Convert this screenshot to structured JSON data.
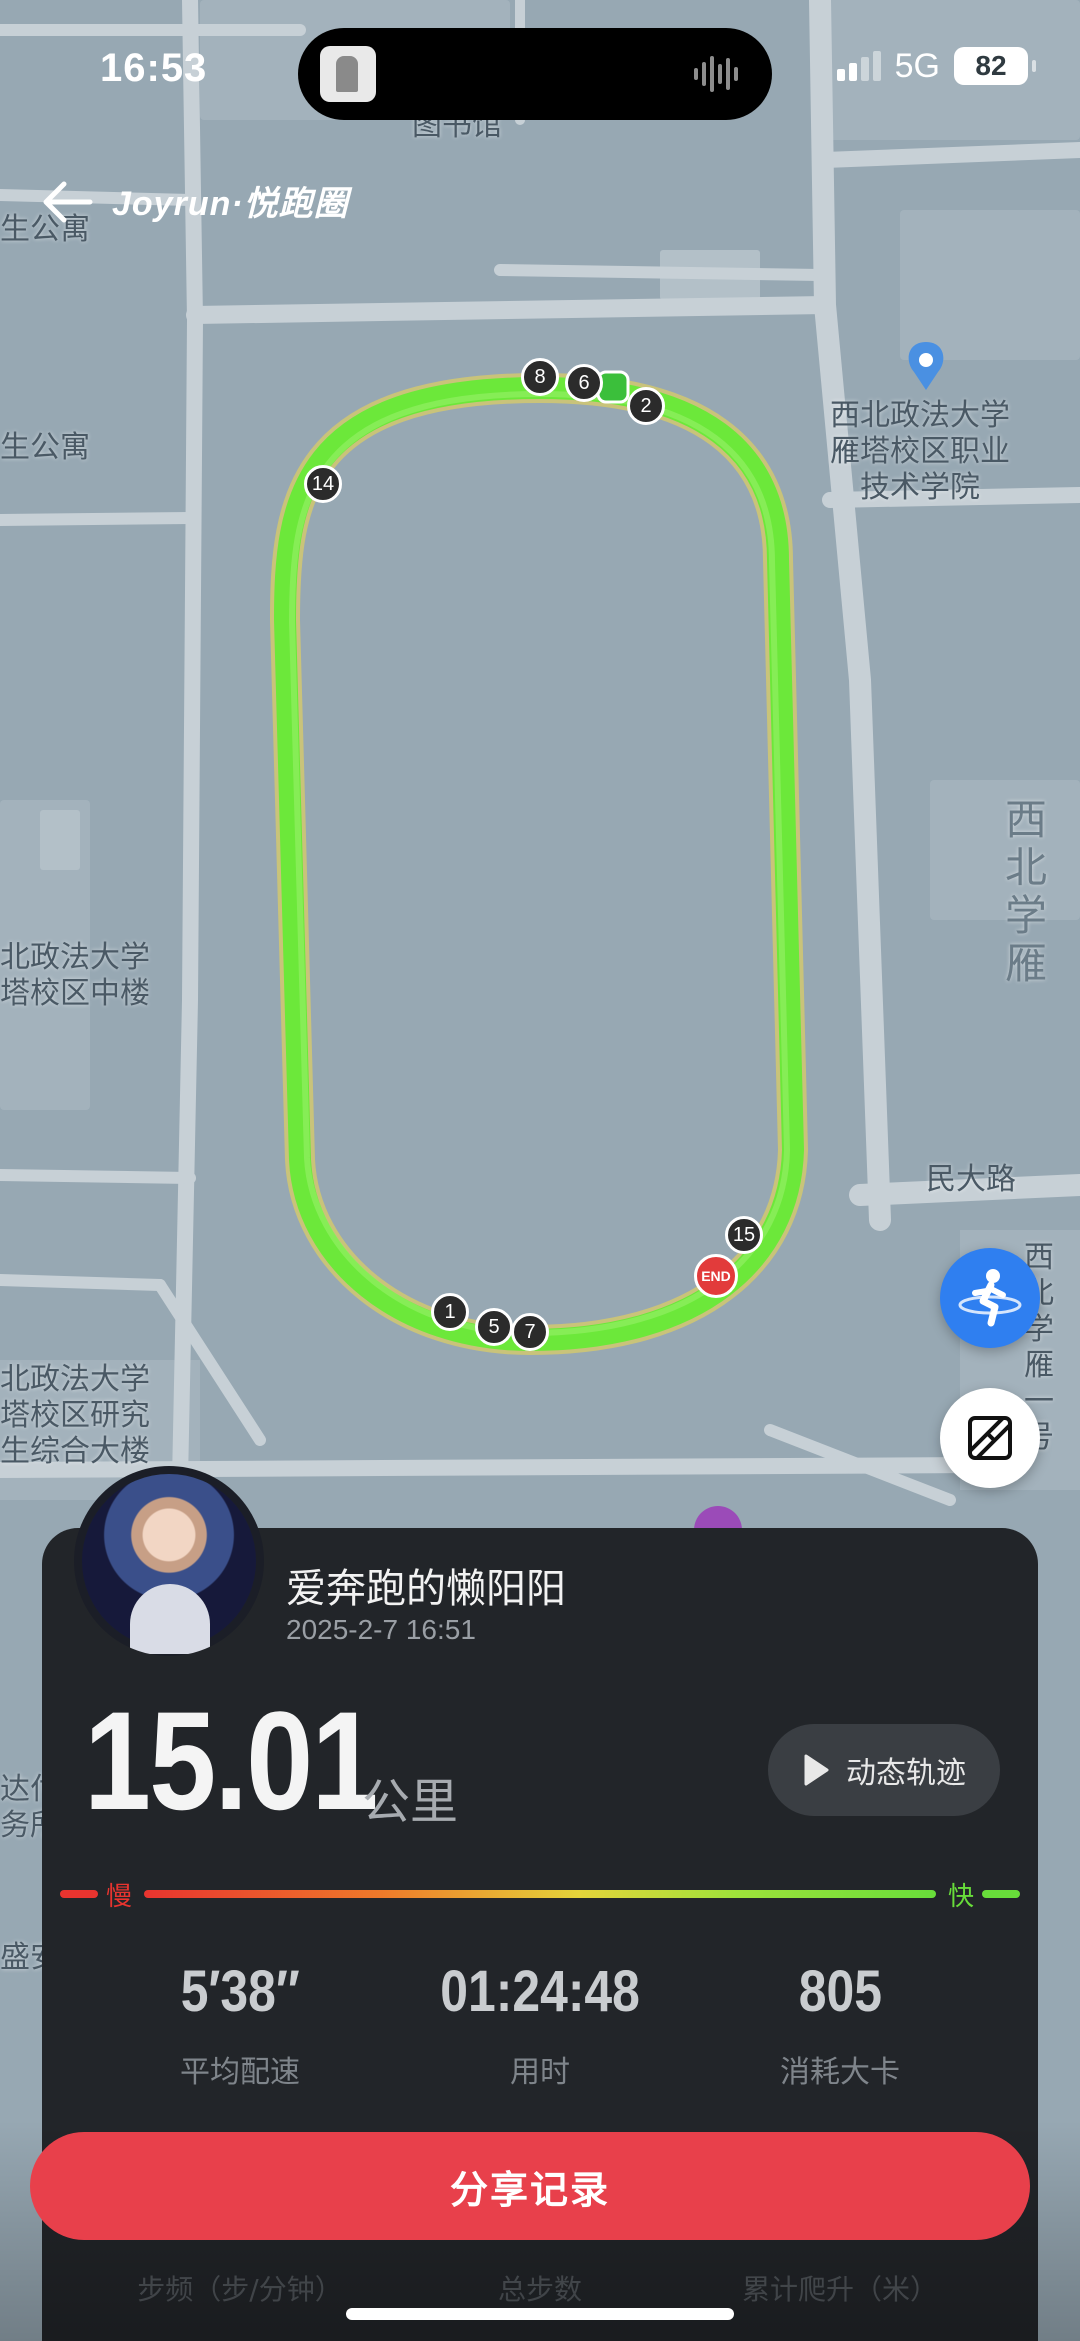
{
  "status_bar": {
    "time": "16:53",
    "network": "5G",
    "battery": "82"
  },
  "header": {
    "brand": "Joyrun·悦跑圈"
  },
  "map": {
    "labels": {
      "library": "图书馆",
      "apartment1": "生公寓",
      "apartment2": "生公寓",
      "college": "西北政法大学\n雁塔校区职业\n技术学院",
      "right_big": "西北\n学雁",
      "middle_building": "北政法大学\n塔校区中楼",
      "road": "民大路",
      "right_small": "西北\n学雁\n一号",
      "research_building": "北政法大学\n塔校区研究\n生综合大楼",
      "left_edge1": "达付\n务所",
      "left_edge2": "盛安"
    },
    "km_markers": [
      "8",
      "6",
      "2",
      "14",
      "15",
      "1",
      "5",
      "7"
    ],
    "end_label": "END",
    "route_color": "#6ce83a"
  },
  "summary": {
    "username": "爱奔跑的懒阳阳",
    "datetime": "2025-2-7 16:51",
    "distance": "15.01",
    "distance_unit": "公里",
    "replay_label": "动态轨迹",
    "pace_slow": "慢",
    "pace_fast": "快",
    "stats": [
      {
        "value": "5′38″",
        "label": "平均配速"
      },
      {
        "value": "01:24:48",
        "label": "用时"
      },
      {
        "value": "805",
        "label": "消耗大卡"
      }
    ],
    "share_label": "分享记录",
    "bottom_labels": [
      "步频（步/分钟）",
      "总步数",
      "累计爬升（米）"
    ]
  },
  "colors": {
    "accent": "#e8404b",
    "card": "#222529",
    "map_bg": "#97a8b3"
  }
}
